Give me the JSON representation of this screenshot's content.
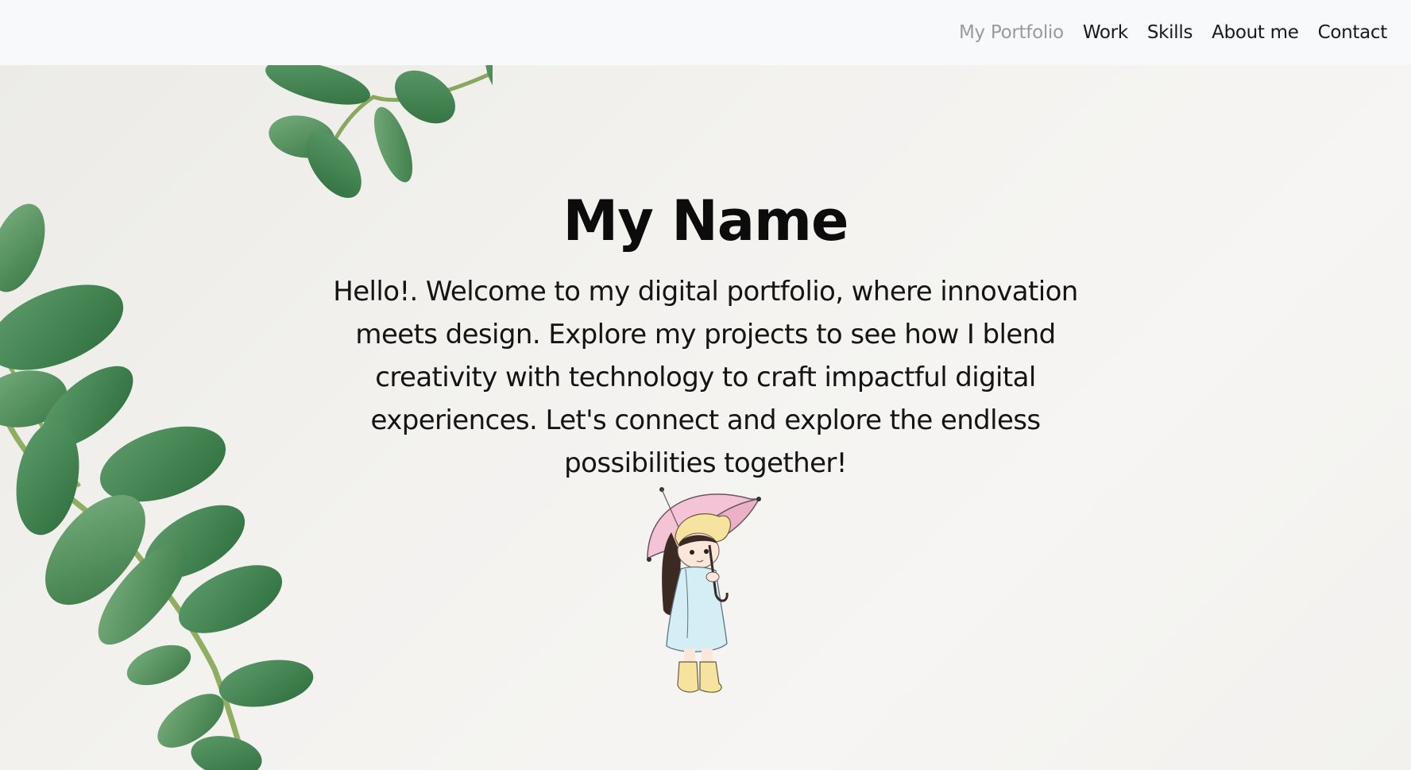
{
  "nav": {
    "brand": "My Portfolio",
    "links": [
      "Work",
      "Skills",
      "About me",
      "Contact"
    ]
  },
  "hero": {
    "title": "My Name",
    "intro": "Hello!. Welcome to my digital portfolio, where innovation meets design. Explore my projects to see how I blend creativity with technology to craft impactful digital experiences. Let's connect and explore the endless possibilities together!"
  },
  "colors": {
    "navbar_bg": "#f8f9fa",
    "nav_muted": "#9a9a9a",
    "text": "#141414",
    "leaf_green": "#3f8a4e",
    "umbrella_pink": "#f4c3d6",
    "coat_blue": "#d5edf4",
    "boots_yellow": "#f7e3a0"
  },
  "icons": [
    "eucalyptus-leaves-decoration",
    "girl-with-umbrella-illustration"
  ]
}
